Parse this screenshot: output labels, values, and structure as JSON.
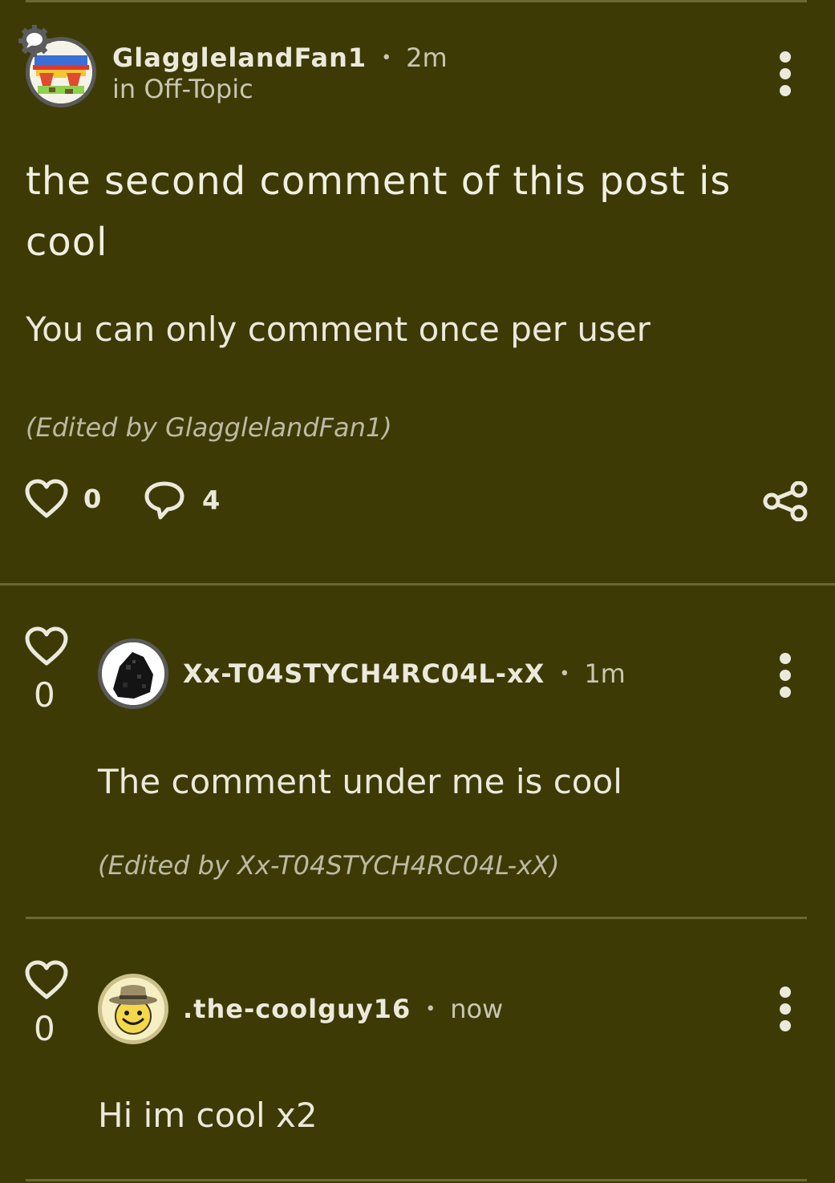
{
  "post": {
    "author": "GlagglelandFan1",
    "separator": "•",
    "time": "2m",
    "community": "in Off-Topic",
    "title": "the second comment of this post is cool",
    "body": "You can only comment once per user",
    "edited_note": "(Edited by GlagglelandFan1)",
    "like_count": "0",
    "comment_count": "4",
    "avatar_icon": "rainbow-sunglasses-avatar",
    "badge_icon": "chat-bubble-gear-icon"
  },
  "comments": [
    {
      "author": "Xx-T04STYCH4RC04L-xX",
      "separator": "•",
      "time": "1m",
      "body": "The comment under me is cool",
      "edited_note": "(Edited by Xx-T04STYCH4RC04L-xX)",
      "like_count": "0",
      "avatar_icon": "charcoal-lump-avatar"
    },
    {
      "author": ".the-coolguy16",
      "separator": "•",
      "time": "now",
      "body": "Hi im cool x2",
      "like_count": "0",
      "avatar_icon": "smiley-fedora-avatar"
    }
  ],
  "colors": {
    "background": "#3d3a05",
    "text": "#ece9dc",
    "muted": "#c9c6b3",
    "divider": "#6b6833"
  }
}
